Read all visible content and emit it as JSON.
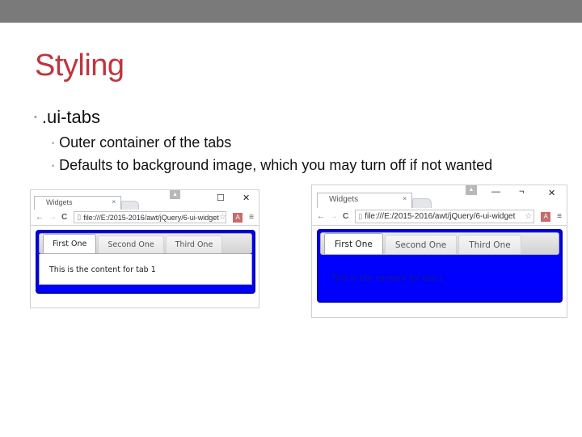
{
  "slide": {
    "title": "Styling",
    "bullets": [
      {
        "text": ".ui-tabs",
        "children": [
          "Outer container of the tabs",
          "Defaults to background image, which you may turn off if not wanted"
        ]
      }
    ],
    "bullet_glyph": "•",
    "colors": {
      "title": "#c0343d",
      "topbar": "#7a7a7a",
      "widget_background": "#0000ff",
      "widget_border": "#0000b0"
    }
  },
  "screenshots": [
    {
      "browser_tab_title": "Widgets",
      "tab_close": "×",
      "profile_icon": "person-icon",
      "window_controls": {
        "maximize": "☐",
        "close": "✕"
      },
      "nav": {
        "back": "←",
        "forward": "→",
        "reload": "C"
      },
      "url": "file:///E:/2015-2016/awt/jQuery/6-ui-widget",
      "star": "☆",
      "acrobat": "A",
      "menu": "≡",
      "tabs": [
        "First One",
        "Second One",
        "Third One"
      ],
      "active_tab": 0,
      "panel_text": "This is the content for tab 1"
    },
    {
      "browser_tab_title": "Widgets",
      "tab_close": "×",
      "profile_icon": "person-icon",
      "window_controls": {
        "minimize": "—",
        "restore": "¬",
        "close": "✕"
      },
      "nav": {
        "back": "←",
        "forward": "→",
        "reload": "C"
      },
      "url": "file:///E:/2015-2016/awt/jQuery/6-ui-widget",
      "star": "☆",
      "acrobat": "A",
      "menu": "≡",
      "tabs": [
        "First One",
        "Second One",
        "Third One"
      ],
      "active_tab": 0,
      "panel_text": "This is the content for tab 1"
    }
  ]
}
